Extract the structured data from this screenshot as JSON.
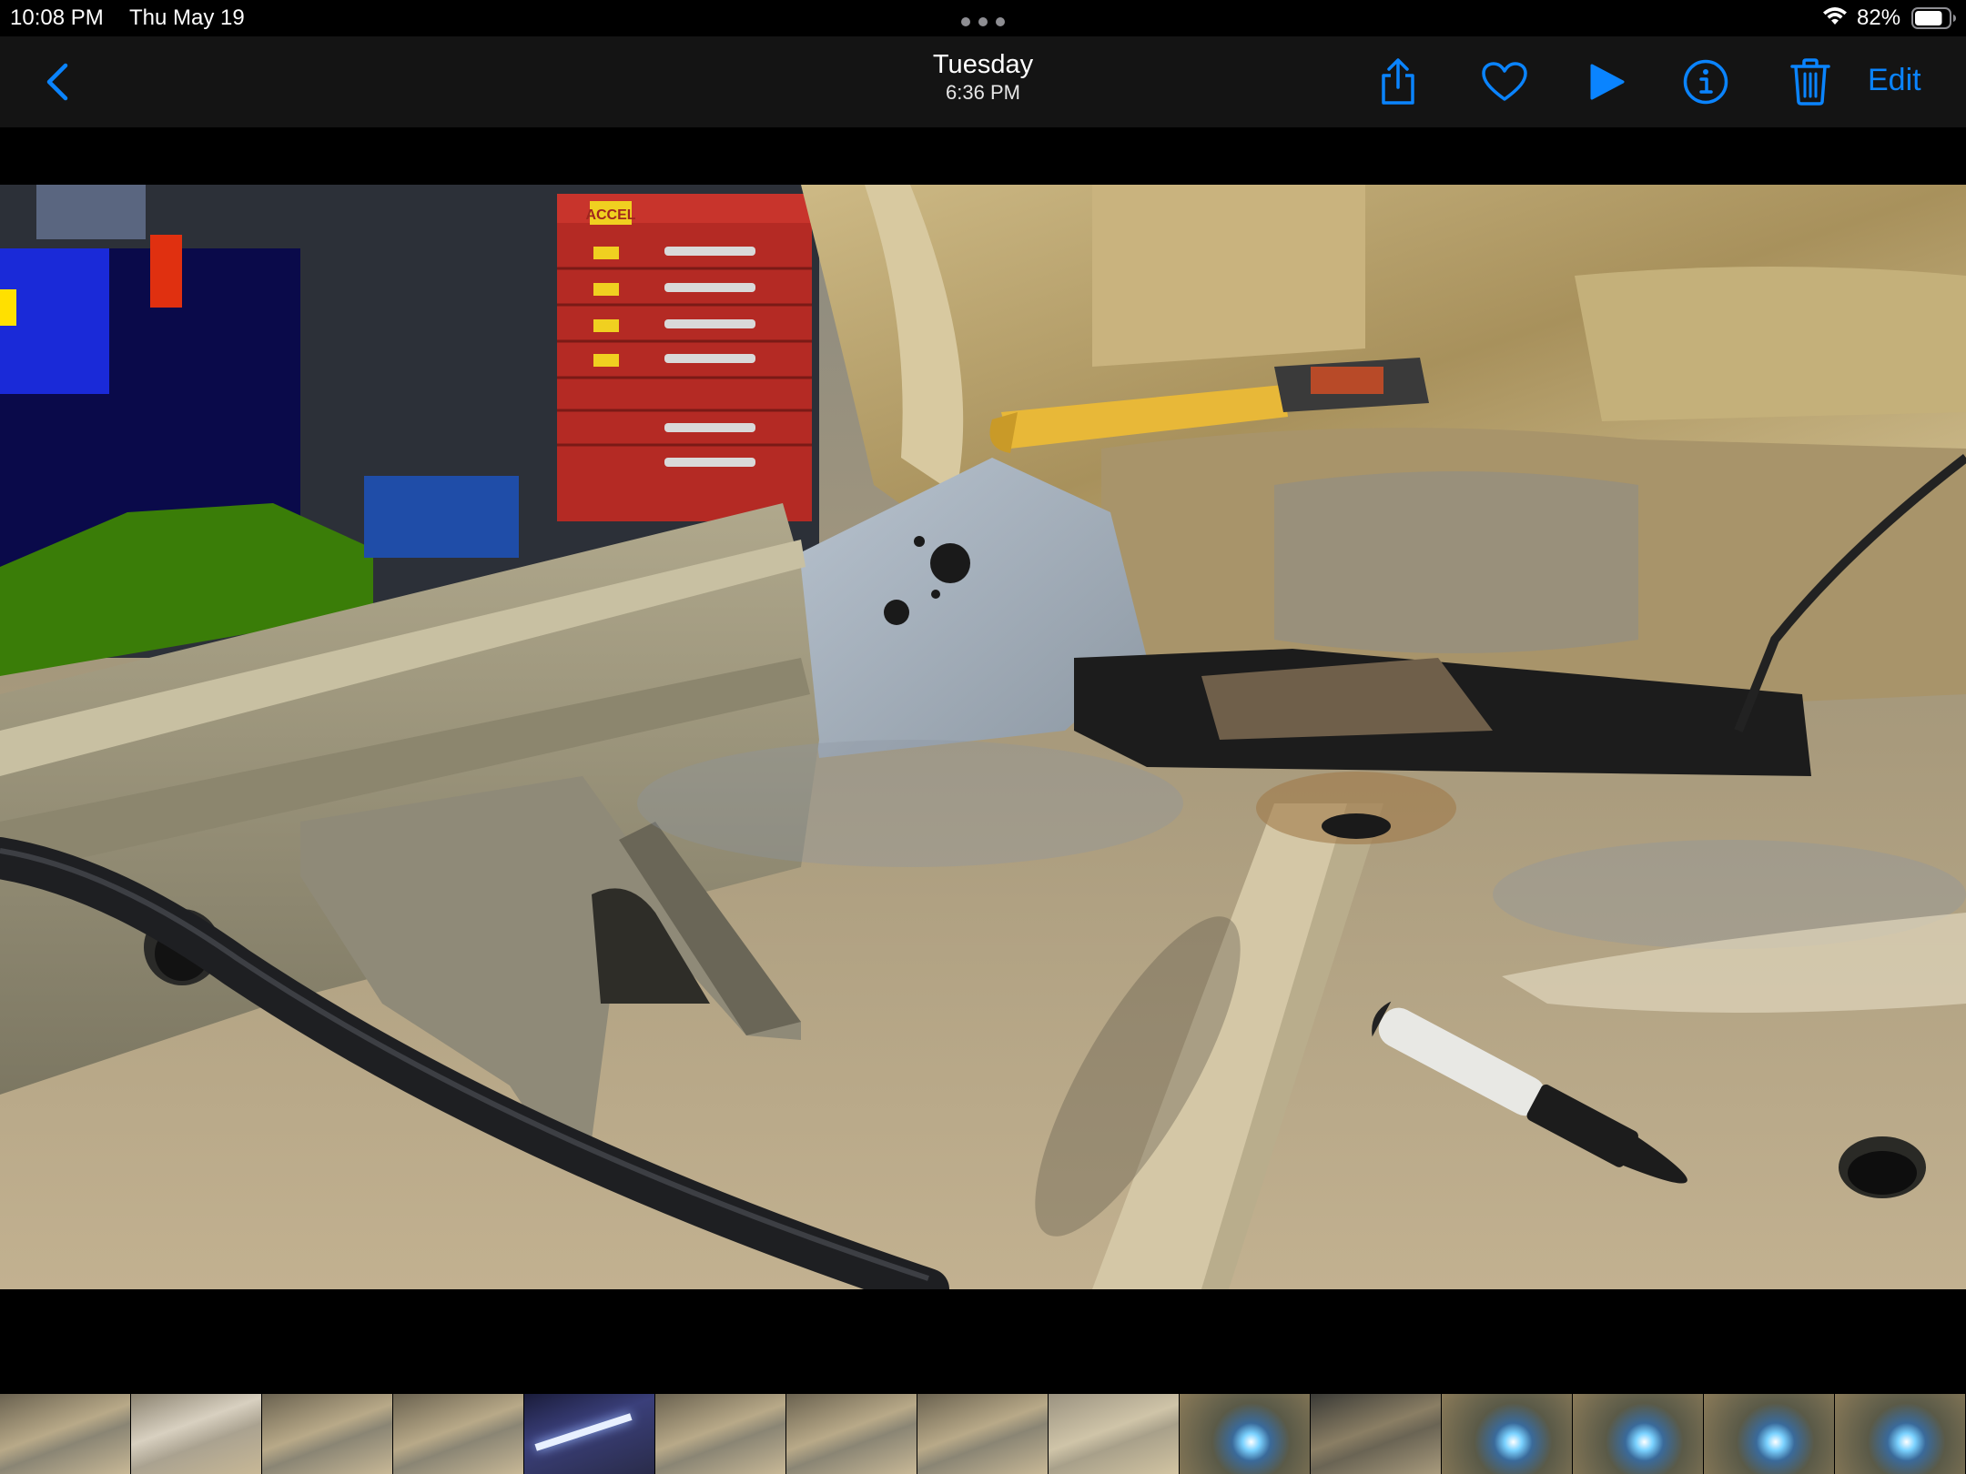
{
  "status_bar": {
    "time": "10:08 PM",
    "date": "Thu May 19",
    "battery_percent": "82%",
    "battery_level": 0.82
  },
  "nav": {
    "title": "Tuesday",
    "subtitle": "6:36 PM",
    "edit_label": "Edit",
    "accent_color": "#0a84ff",
    "icons": [
      "back-chevron-icon",
      "share-icon",
      "heart-icon",
      "play-icon",
      "info-icon",
      "trash-icon"
    ]
  },
  "photo": {
    "stamped_text": {
      "toolbox_brand": "ACCEL"
    }
  },
  "filmstrip": {
    "thumbnails": [
      {
        "kind": "floor"
      },
      {
        "kind": "floor-bright"
      },
      {
        "kind": "floor"
      },
      {
        "kind": "floor"
      },
      {
        "kind": "light-bar"
      },
      {
        "kind": "floor"
      },
      {
        "kind": "floor"
      },
      {
        "kind": "floor"
      },
      {
        "kind": "floor-light"
      },
      {
        "kind": "weld-spark"
      },
      {
        "kind": "floor-dark"
      },
      {
        "kind": "weld-spark"
      },
      {
        "kind": "weld-spark"
      },
      {
        "kind": "weld-spark"
      },
      {
        "kind": "weld-spark"
      }
    ]
  }
}
